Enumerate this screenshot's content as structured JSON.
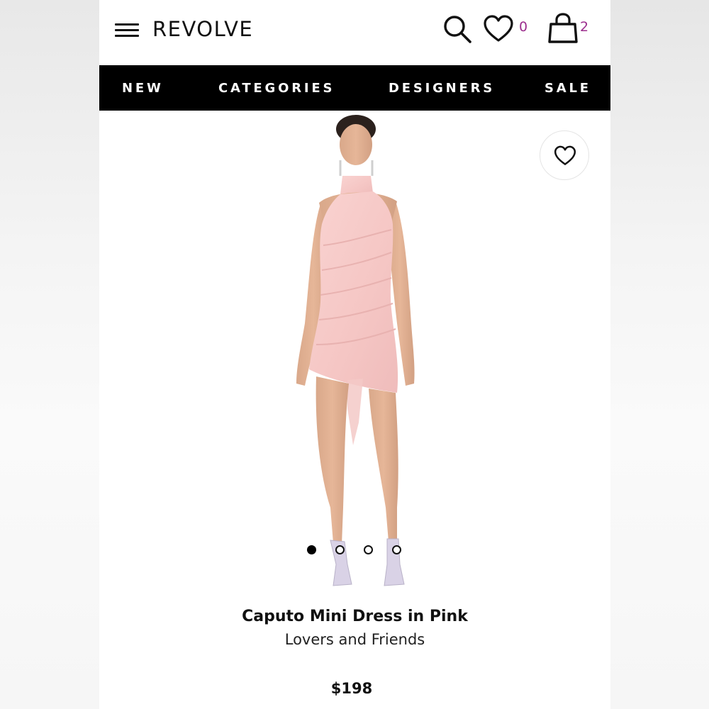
{
  "header": {
    "logo": "REVOLVE",
    "menu_icon": "hamburger-menu-icon",
    "search_icon": "search-icon",
    "wishlist_icon": "heart-icon",
    "wishlist_count": "0",
    "bag_icon": "shopping-bag-icon",
    "bag_count": "2",
    "count_color": "#9c2f8e"
  },
  "nav": {
    "items": [
      {
        "label": "NEW"
      },
      {
        "label": "CATEGORIES"
      },
      {
        "label": "DESIGNERS"
      },
      {
        "label": "SALE"
      }
    ],
    "background": "#000000"
  },
  "product": {
    "image_icon": "model-photo",
    "wishlist_button_icon": "heart-icon",
    "carousel": {
      "total": 4,
      "active_index": 0
    },
    "name": "Caputo Mini Dress in Pink",
    "brand": "Lovers and Friends",
    "price": "$198",
    "dress_color": "#f6c9c9"
  }
}
